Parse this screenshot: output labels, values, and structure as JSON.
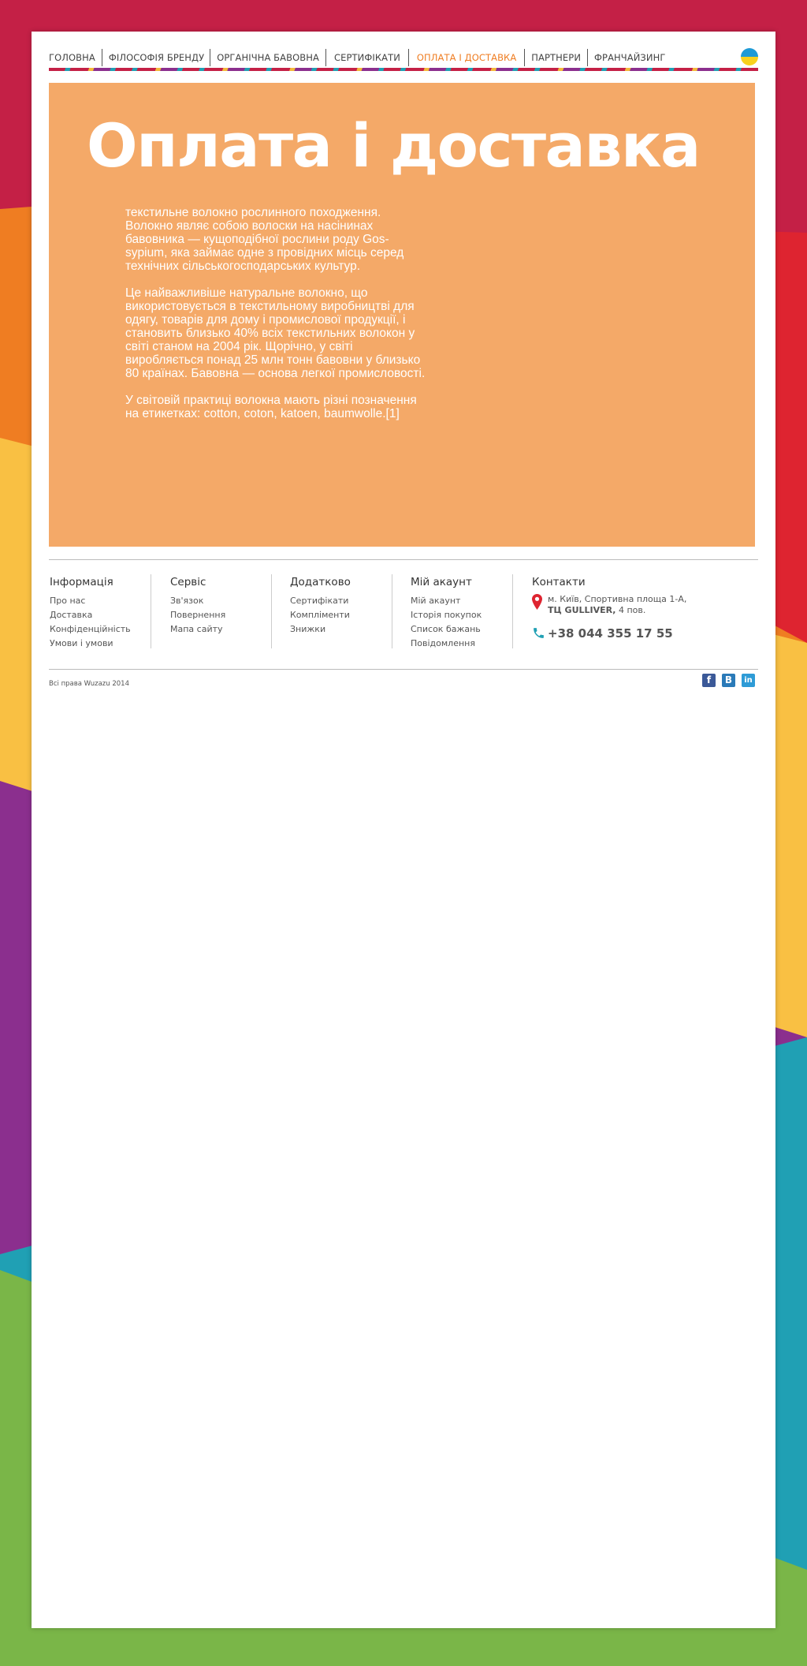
{
  "nav": {
    "items": [
      {
        "label": "ГОЛОВНА"
      },
      {
        "label": "ФІЛОСОФІЯ БРЕНДУ"
      },
      {
        "label": "ОРГАНІЧНА БАВОВНА"
      },
      {
        "label": "СЕРТИФІКАТИ"
      },
      {
        "label": "ОПЛАТА І ДОСТАВКА"
      },
      {
        "label": "ПАРТНЕРИ"
      },
      {
        "label": "ФРАНЧАЙЗИНГ"
      }
    ],
    "active_index": 4,
    "language_icon": "ukraine-flag-icon"
  },
  "hero": {
    "title": "Оплата і доставка",
    "paragraphs": [
      "текстильне волокно рослинного походження. Волокно являє собою волоски на насінинах бавовника — кущоподібної рослини роду Gos-sypium, яка займає одне з провідних місць серед технічних сільськогосподарських культур.",
      "Це найважливіше натуральне волокно, що використовується в текстильному виробництві для одягу, товарів для дому і промислової продукції, і становить близько 40% всіх текстильних волокон у світі станом на 2004 рік. Щорічно, у світі виробляється понад 25 млн тонн бавовни у близько 80 країнах. Бавовна — основа легкої промисловості.",
      "У світовій практиці волокна мають різні позначення на етикетках: cotton, coton, katoen, baumwolle.[1]"
    ]
  },
  "footer": {
    "columns": [
      {
        "title": "Інформація",
        "links": [
          "Про нас",
          "Доставка",
          "Конфіденційність",
          "Умови і умови"
        ]
      },
      {
        "title": "Сервіс",
        "links": [
          "Зв'язок",
          "Повернення",
          "Мапа сайту"
        ]
      },
      {
        "title": "Додатково",
        "links": [
          "Сертифікати",
          "Компліменти",
          "Знижки"
        ]
      },
      {
        "title": "Мій акаунт",
        "links": [
          "Мій акаунт",
          "Історія покупок",
          "Список бажань",
          "Повідомлення"
        ]
      }
    ],
    "contacts": {
      "title": "Контакти",
      "address_line1": "м. Київ, Спортивна площа 1-А,",
      "address_mall": "ТЦ GULLIVER,",
      "address_floor": " 4 пов.",
      "phone": "+38 044 355 17 55"
    },
    "copyright": "Всі права Wuzazu 2014",
    "social": [
      {
        "icon": "facebook-icon",
        "glyph": "f",
        "color": "#3b5998"
      },
      {
        "icon": "vkontakte-icon",
        "glyph": "B",
        "color": "#2a7ab8"
      },
      {
        "icon": "linkedin-icon",
        "glyph": "in",
        "color": "#2e9bd6"
      }
    ]
  },
  "colors": {
    "accent": "#ef7d22",
    "hero_bg": "#f4a968",
    "bg_magenta": "#c42046",
    "bg_red": "#de2430",
    "bg_orange": "#ef7d22",
    "bg_yellow": "#f9c043",
    "bg_purple": "#8b2f8e",
    "bg_teal": "#20a0b4",
    "bg_green": "#7ab648"
  }
}
